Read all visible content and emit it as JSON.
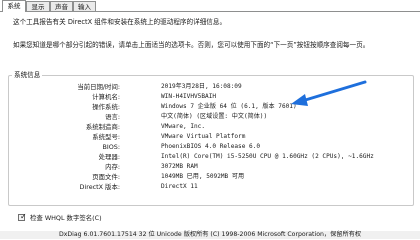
{
  "tabs": [
    "系统",
    "显示",
    "声音",
    "输入"
  ],
  "intro": {
    "line1": "这个工具报告有关 DirectX 组件和安装在系统上的驱动程序的详细信息。",
    "line2": "如果您知道是哪个部分引起的错误，请单击上面适当的选项卡。否则，您可以使用下面的“下一页”按钮按顺序查阅每一页。"
  },
  "system_info": {
    "title": "系统信息",
    "rows": [
      {
        "label": "当前日期/时间:",
        "value": "2019年3月28日, 16:08:09"
      },
      {
        "label": "计算机名:",
        "value": "WIN-H4IVHV5BAIH"
      },
      {
        "label": "操作系统:",
        "value": "Windows 7 企业版 64 位 (6.1, 版本 7601)"
      },
      {
        "label": "语言:",
        "value": "中文(简体) (区域设置: 中文(简体))"
      },
      {
        "label": "系统制造商:",
        "value": "VMware, Inc."
      },
      {
        "label": "系统型号:",
        "value": "VMware Virtual Platform"
      },
      {
        "label": "BIOS:",
        "value": "PhoenixBIOS 4.0 Release 6.0"
      },
      {
        "label": "处理器:",
        "value": "Intel(R) Core(TM) i5-5250U CPU @ 1.60GHz (2 CPUs), ~1.6GHz"
      },
      {
        "label": "内存:",
        "value": "3072MB RAM"
      },
      {
        "label": "页面文件:",
        "value": "1049MB 已用, 5092MB 可用"
      },
      {
        "label": "DirectX 版本:",
        "value": "DirectX 11"
      }
    ]
  },
  "whql": {
    "label": "检查 WHQL 数字签名(C)",
    "checked": true,
    "mark": "✓"
  },
  "footer": "DxDiag 6.01.7601.17514 32 位 Unicode 版权所有 (C) 1998-2006 Microsoft Corporation，保留所有权",
  "colors": {
    "arrow": "#1e6fdc",
    "border": "#8e8f8f"
  }
}
